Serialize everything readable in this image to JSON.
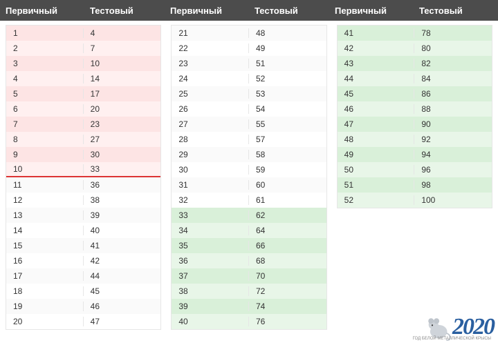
{
  "headers": {
    "primary": "Первичный",
    "test": "Тестовый"
  },
  "col1": {
    "red_band": [
      {
        "p": 1,
        "t": 4
      },
      {
        "p": 2,
        "t": 7
      },
      {
        "p": 3,
        "t": 10
      },
      {
        "p": 4,
        "t": 14
      },
      {
        "p": 5,
        "t": 17
      },
      {
        "p": 6,
        "t": 20
      },
      {
        "p": 7,
        "t": 23
      },
      {
        "p": 8,
        "t": 27
      },
      {
        "p": 9,
        "t": 30
      },
      {
        "p": 10,
        "t": 33
      }
    ],
    "plain": [
      {
        "p": 11,
        "t": 36
      },
      {
        "p": 12,
        "t": 38
      },
      {
        "p": 13,
        "t": 39
      },
      {
        "p": 14,
        "t": 40
      },
      {
        "p": 15,
        "t": 41
      },
      {
        "p": 16,
        "t": 42
      },
      {
        "p": 17,
        "t": 44
      },
      {
        "p": 18,
        "t": 45
      },
      {
        "p": 19,
        "t": 46
      },
      {
        "p": 20,
        "t": 47
      }
    ]
  },
  "col2": {
    "plain": [
      {
        "p": 21,
        "t": 48
      },
      {
        "p": 22,
        "t": 49
      },
      {
        "p": 23,
        "t": 51
      },
      {
        "p": 24,
        "t": 52
      },
      {
        "p": 25,
        "t": 53
      },
      {
        "p": 26,
        "t": 54
      },
      {
        "p": 27,
        "t": 55
      },
      {
        "p": 28,
        "t": 57
      },
      {
        "p": 29,
        "t": 58
      },
      {
        "p": 30,
        "t": 59
      },
      {
        "p": 31,
        "t": 60
      },
      {
        "p": 32,
        "t": 61
      }
    ],
    "green_band": [
      {
        "p": 33,
        "t": 62
      },
      {
        "p": 34,
        "t": 64
      },
      {
        "p": 35,
        "t": 66
      },
      {
        "p": 36,
        "t": 68
      },
      {
        "p": 37,
        "t": 70
      },
      {
        "p": 38,
        "t": 72
      },
      {
        "p": 39,
        "t": 74
      },
      {
        "p": 40,
        "t": 76
      }
    ]
  },
  "col3": {
    "green_band": [
      {
        "p": 41,
        "t": 78
      },
      {
        "p": 42,
        "t": 80
      },
      {
        "p": 43,
        "t": 82
      },
      {
        "p": 44,
        "t": 84
      },
      {
        "p": 45,
        "t": 86
      },
      {
        "p": 46,
        "t": 88
      },
      {
        "p": 47,
        "t": 90
      },
      {
        "p": 48,
        "t": 92
      },
      {
        "p": 49,
        "t": 94
      },
      {
        "p": 50,
        "t": 96
      },
      {
        "p": 51,
        "t": 98
      },
      {
        "p": 52,
        "t": 100
      }
    ]
  },
  "watermark": {
    "year": "2020",
    "subtitle": "ГОД БЕЛОЙ МЕТАЛЛИЧЕСКОЙ КРЫСЫ"
  }
}
